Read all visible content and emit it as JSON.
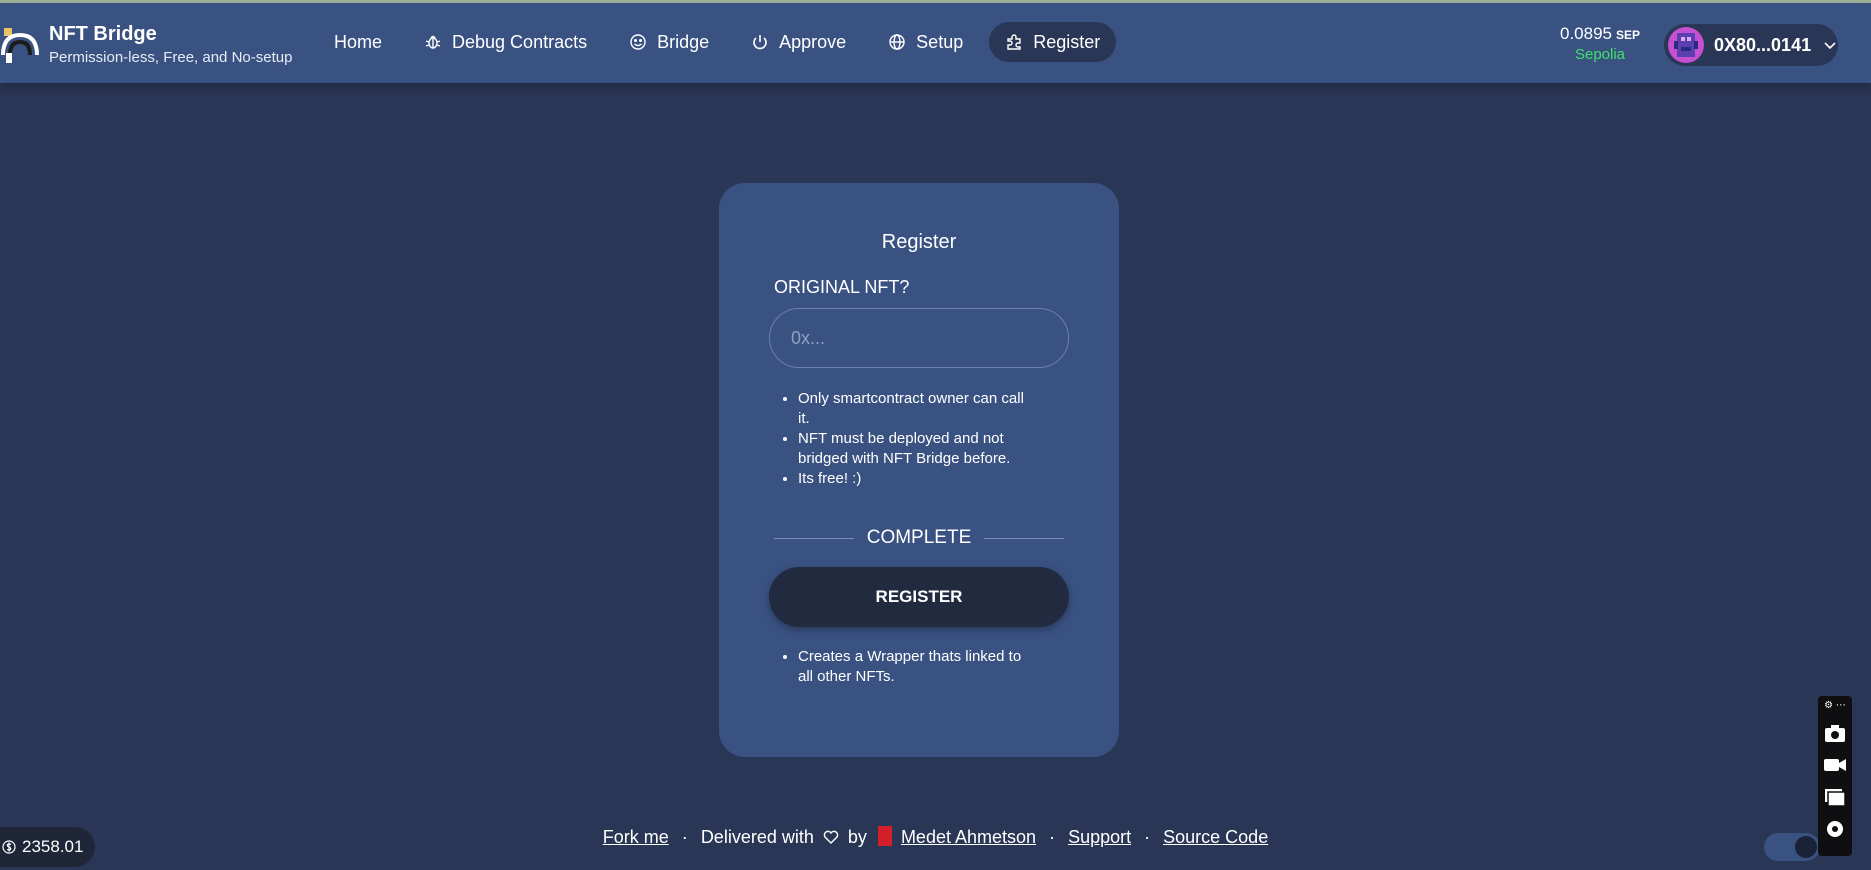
{
  "brand": {
    "title": "NFT Bridge",
    "subtitle": "Permission-less, Free, and No-setup"
  },
  "nav": [
    {
      "label": "Home",
      "icon": "none"
    },
    {
      "label": "Debug Contracts",
      "icon": "bug-icon"
    },
    {
      "label": "Bridge",
      "icon": "smile-icon"
    },
    {
      "label": "Approve",
      "icon": "power-icon"
    },
    {
      "label": "Setup",
      "icon": "globe-icon"
    },
    {
      "label": "Register",
      "icon": "puzzle-icon",
      "active": true
    }
  ],
  "wallet": {
    "balance": "0.0895",
    "unit": "SEP",
    "network": "Sepolia",
    "address": "0X80...0141"
  },
  "card": {
    "title": "Register",
    "field_label": "ORIGINAL NFT?",
    "input_placeholder": "0x...",
    "input_value": "",
    "notes": [
      "Only smartcontract owner can call it.",
      "NFT must be deployed and not bridged with NFT Bridge before.",
      "Its free! :)"
    ],
    "divider": "COMPLETE",
    "button": "REGISTER",
    "notes2": [
      "Creates a Wrapper thats linked to all other NFTs."
    ]
  },
  "footer": {
    "fork": "Fork me",
    "delivered": "Delivered with",
    "by": "by",
    "author": "Medet Ahmetson",
    "support": "Support",
    "source": "Source Code",
    "sep": "·"
  },
  "price": "2358.01",
  "colors": {
    "background": "#2a3655",
    "header": "#3a5282",
    "card": "#3a5282",
    "button": "#222a40",
    "network": "#3ee06a"
  }
}
